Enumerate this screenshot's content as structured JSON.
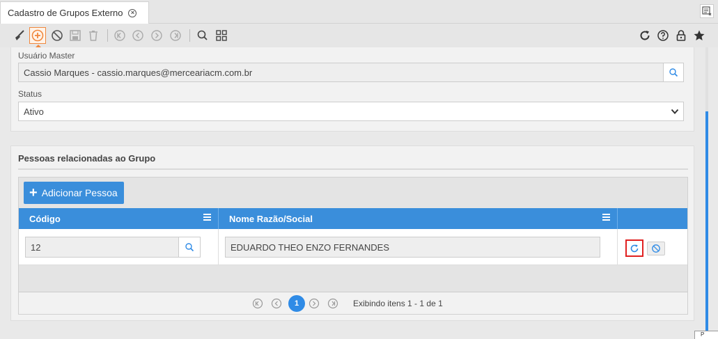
{
  "tab": {
    "title": "Cadastro de Grupos Externo",
    "close_icon": "close-circle-icon"
  },
  "toolbar": {
    "left_icons": [
      "broom-icon",
      "add-circle-icon",
      "ban-icon",
      "save-icon",
      "trash-icon",
      "first-page-icon",
      "previous-icon",
      "next-icon",
      "last-page-icon",
      "search-icon",
      "grid-icon"
    ],
    "right_icons": [
      "refresh-icon",
      "help-icon",
      "lock-icon",
      "star-icon"
    ]
  },
  "form": {
    "usuario_master": {
      "label": "Usuário Master",
      "value": "Cassio Marques - cassio.marques@merceariacm.com.br"
    },
    "status": {
      "label": "Status",
      "value": "Ativo"
    }
  },
  "section": {
    "title": "Pessoas relacionadas ao Grupo",
    "add_button_label": "Adicionar Pessoa"
  },
  "grid": {
    "columns": [
      "Código",
      "Nome Razão/Social"
    ],
    "rows": [
      {
        "codigo": "12",
        "nome": "EDUARDO THEO ENZO FERNANDES"
      }
    ]
  },
  "pagination": {
    "current_page": "1",
    "info": "Exibindo itens 1 - 1 de 1"
  },
  "corner_tip": "P",
  "colors": {
    "accent": "#3a8edb",
    "active_tool": "#f0883e",
    "highlight": "#e02020"
  }
}
